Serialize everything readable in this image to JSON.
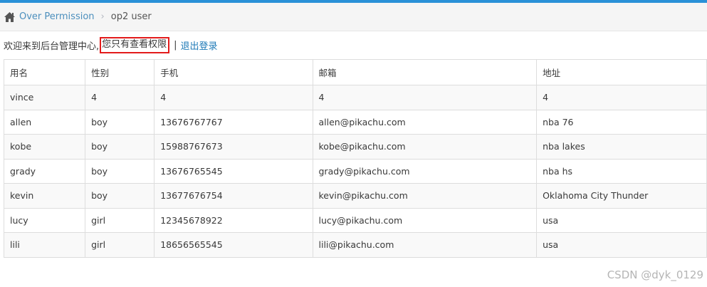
{
  "breadcrumb": {
    "home_link": "Over Permission",
    "separator": "›",
    "current": "op2 user"
  },
  "welcome": {
    "text": "欢迎来到后台管理中心,",
    "permission_text": "您只有查看权限",
    "separator": "|",
    "logout_link": "退出登录"
  },
  "table": {
    "headers": [
      "用名",
      "性别",
      "手机",
      "邮箱",
      "地址"
    ],
    "rows": [
      [
        "vince",
        "4",
        "4",
        "4",
        "4"
      ],
      [
        "allen",
        "boy",
        "13676767767",
        "allen@pikachu.com",
        "nba 76"
      ],
      [
        "kobe",
        "boy",
        "15988767673",
        "kobe@pikachu.com",
        "nba lakes"
      ],
      [
        "grady",
        "boy",
        "13676765545",
        "grady@pikachu.com",
        "nba hs"
      ],
      [
        "kevin",
        "boy",
        "13677676754",
        "kevin@pikachu.com",
        "Oklahoma City Thunder"
      ],
      [
        "lucy",
        "girl",
        "12345678922",
        "lucy@pikachu.com",
        "usa"
      ],
      [
        "lili",
        "girl",
        "18656565545",
        "lili@pikachu.com",
        "usa"
      ]
    ]
  },
  "watermark": "CSDN @dyk_0129",
  "colors": {
    "accent_bar": "#2a91d8",
    "link": "#4c8fbd",
    "highlight_border": "#e31b1b"
  },
  "icons": {
    "home": "home-icon"
  }
}
